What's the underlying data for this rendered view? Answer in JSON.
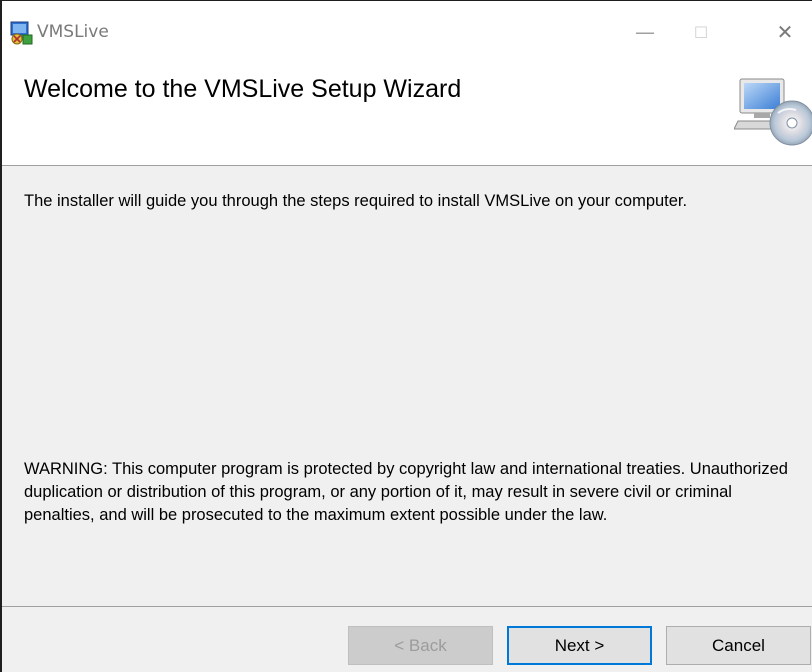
{
  "window": {
    "title": "VMSLive",
    "controls": {
      "minimize": "—",
      "maximize": "☐",
      "close": "✕"
    }
  },
  "banner": {
    "title": "Welcome to the VMSLive Setup Wizard",
    "icon": "computer-cd-icon"
  },
  "content": {
    "intro": "The installer will guide you through the steps required to install VMSLive on your computer.",
    "warning": "WARNING: This computer program is protected by copyright law and international treaties. Unauthorized duplication or distribution of this program, or any portion of it, may result in severe civil or criminal penalties, and will be prosecuted to the maximum extent possible under the law."
  },
  "buttons": {
    "back": "< Back",
    "next": "Next >",
    "cancel": "Cancel"
  },
  "colors": {
    "accent": "#0078d7",
    "dialog_bg": "#f0f0f0",
    "banner_bg": "#ffffff"
  }
}
